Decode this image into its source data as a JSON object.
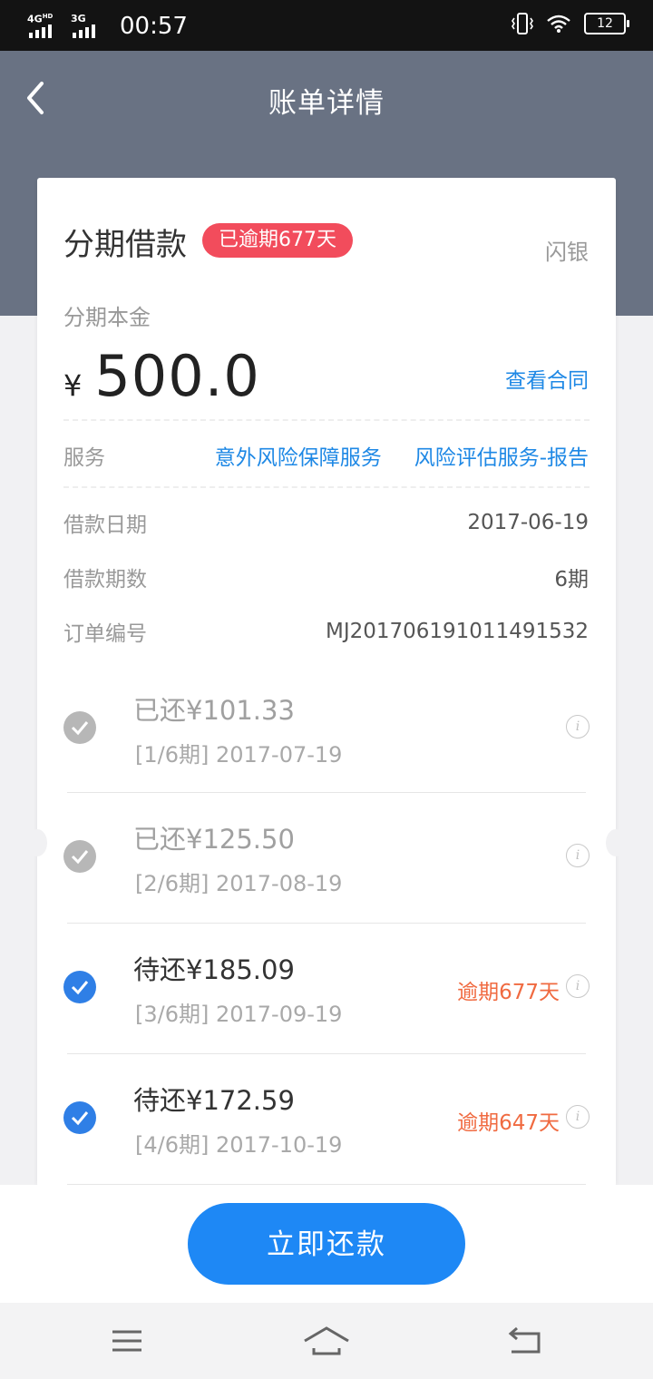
{
  "status_bar": {
    "net1": "4G",
    "net1_sup": "HD",
    "net2": "3G",
    "time": "00:57",
    "battery": "12"
  },
  "header": {
    "title": "账单详情"
  },
  "card": {
    "title": "分期借款",
    "overdue_badge": "已逾期677天",
    "lender": "闪银",
    "principal_label": "分期本金",
    "currency": "¥",
    "amount": "500.0",
    "contract_link": "查看合同",
    "service_label": "服务",
    "services": [
      "意外风险保障服务",
      "风险评估服务-报告"
    ],
    "details": [
      {
        "key": "借款日期",
        "value": "2017-06-19"
      },
      {
        "key": "借款期数",
        "value": "6期"
      },
      {
        "key": "订单编号",
        "value": "MJ20170619101149​1532"
      }
    ]
  },
  "installments": [
    {
      "status": "paid",
      "amount": "已还¥101.33",
      "period": "[1/6期] 2017-07-19",
      "overdue": ""
    },
    {
      "status": "paid",
      "amount": "已还¥125.50",
      "period": "[2/6期] 2017-08-19",
      "overdue": ""
    },
    {
      "status": "due",
      "amount": "待还¥185.09",
      "period": "[3/6期] 2017-09-19",
      "overdue": "逾期677天"
    },
    {
      "status": "due",
      "amount": "待还¥172.59",
      "period": "[4/6期] 2017-10-19",
      "overdue": "逾期647天"
    }
  ],
  "actions": {
    "pay_now": "立即还款"
  },
  "colors": {
    "header_bg": "#697283",
    "accent_blue": "#1e88f5",
    "badge_red": "#f24c5c",
    "overdue_orange": "#f06a40"
  }
}
